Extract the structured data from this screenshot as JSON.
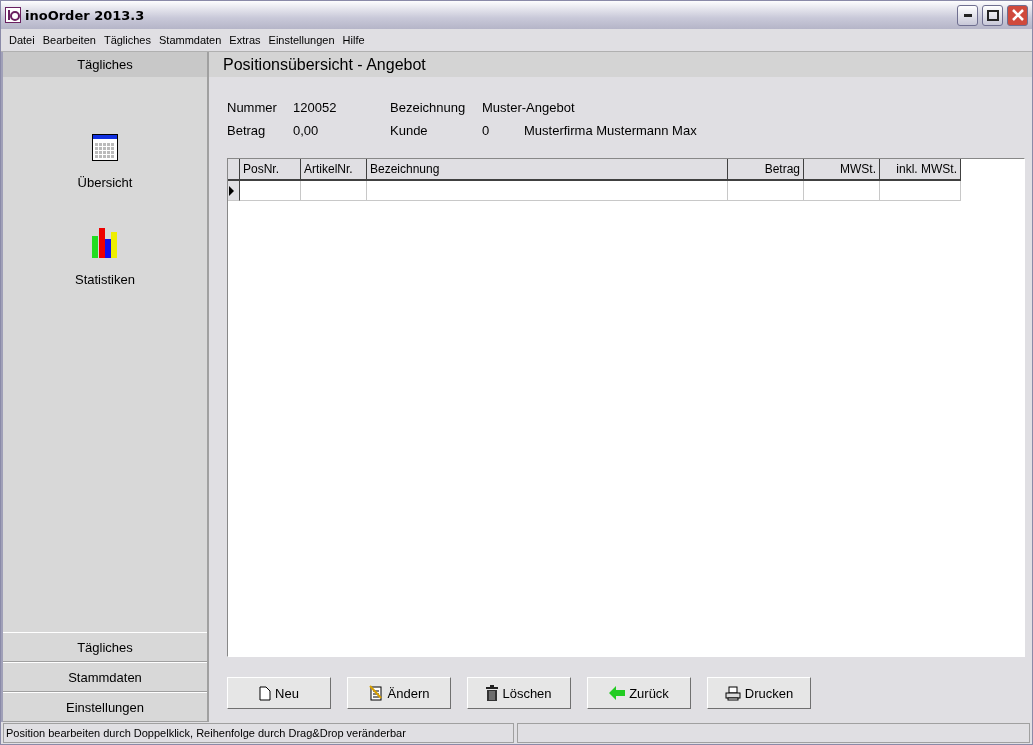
{
  "window": {
    "title": "inoOrder 2013.3"
  },
  "menu": [
    "Datei",
    "Bearbeiten",
    "Tägliches",
    "Stammdaten",
    "Extras",
    "Einstellungen",
    "Hilfe"
  ],
  "sidebar": {
    "header": "Tägliches",
    "items": [
      {
        "kind": "calendar",
        "label": "Übersicht"
      },
      {
        "kind": "chart",
        "label": "Statistiken"
      }
    ],
    "groups": [
      "Tägliches",
      "Stammdaten",
      "Einstellungen"
    ]
  },
  "page": {
    "title": "Positionsübersicht - Angebot",
    "fields": [
      {
        "label": "Nummer",
        "value": "120052"
      },
      {
        "label": "Bezeichnung",
        "value": "Muster-Angebot"
      },
      {
        "label": "Betrag",
        "value": "0,00"
      },
      {
        "label": "Kunde",
        "value": "0",
        "extra": "Musterfirma Mustermann Max"
      }
    ],
    "table": {
      "columns": [
        {
          "label": "PosNr.",
          "kind": "text"
        },
        {
          "label": "ArtikelNr.",
          "kind": "text"
        },
        {
          "label": "Bezeichnung",
          "kind": "text"
        },
        {
          "label": "Betrag",
          "kind": "number"
        },
        {
          "label": "MWSt.",
          "kind": "number"
        },
        {
          "label": "inkl. MWSt.",
          "kind": "number"
        }
      ]
    },
    "buttons": [
      {
        "kind": "new",
        "label": "Neu"
      },
      {
        "kind": "edit",
        "label": "Ändern"
      },
      {
        "kind": "delete",
        "label": "Löschen"
      },
      {
        "kind": "back",
        "label": "Zurück"
      },
      {
        "kind": "print",
        "label": "Drucken"
      }
    ]
  },
  "status_bar": {
    "text": "Position bearbeiten durch Doppelklick, Reihenfolge durch Drag&Drop veränderbar"
  }
}
